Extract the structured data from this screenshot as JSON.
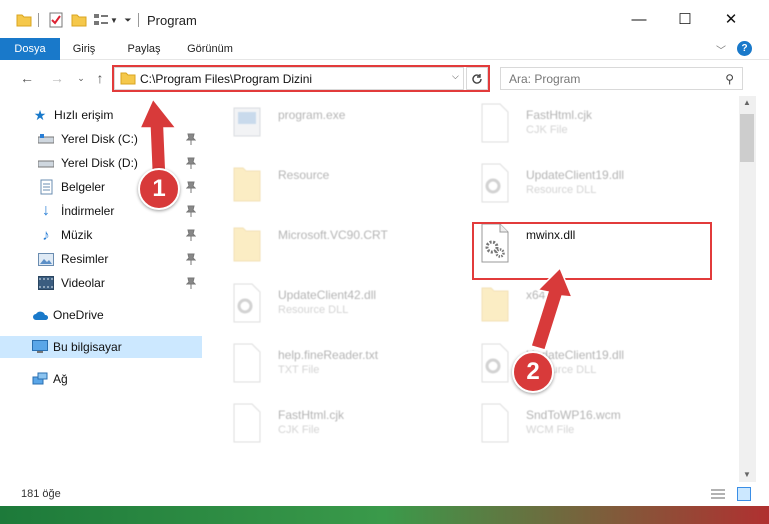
{
  "window": {
    "title": "Program",
    "controls": {
      "minimize": "—",
      "maximize": "☐",
      "close": "✕"
    }
  },
  "ribbon": {
    "tabs": [
      {
        "label": "Dosya",
        "active": true
      },
      {
        "label": "Giriş",
        "active": false
      },
      {
        "label": "Paylaş",
        "active": false
      },
      {
        "label": "Görünüm",
        "active": false
      }
    ]
  },
  "address": {
    "path": "C:\\Program Files\\Program Dizini",
    "search_placeholder": "Ara: Program"
  },
  "sidebar": {
    "quick_access": "Hızlı erişim",
    "items": [
      {
        "label": "Yerel Disk (C:)",
        "icon": "drive-icon"
      },
      {
        "label": "Yerel Disk (D:)",
        "icon": "drive-icon"
      },
      {
        "label": "Belgeler",
        "icon": "documents-icon"
      },
      {
        "label": "İndirmeler",
        "icon": "downloads-icon"
      },
      {
        "label": "Müzik",
        "icon": "music-icon"
      },
      {
        "label": "Resimler",
        "icon": "pictures-icon"
      },
      {
        "label": "Videolar",
        "icon": "videos-icon"
      }
    ],
    "onedrive": "OneDrive",
    "this_pc": "Bu bilgisayar",
    "network": "Ağ"
  },
  "files": {
    "left": [
      {
        "name": "program.exe",
        "type": "",
        "icon": "exe-icon"
      },
      {
        "name": "Resource",
        "type": "",
        "icon": "folder-icon"
      },
      {
        "name": "Microsoft.VC90.CRT",
        "type": "",
        "icon": "folder-icon"
      },
      {
        "name": "UpdateClient42.dll",
        "type": "Resource DLL",
        "icon": "dll-icon"
      },
      {
        "name": "help.fineReader.txt",
        "type": "TXT File",
        "icon": "txt-icon"
      },
      {
        "name": "FastHtml.cjk",
        "type": "CJK File",
        "icon": "file-icon"
      }
    ],
    "right": [
      {
        "name": "FastHtml.cjk",
        "type": "CJK File",
        "icon": "file-icon"
      },
      {
        "name": "UpdateClient19.dll",
        "type": "Resource DLL",
        "icon": "dll-icon"
      },
      {
        "name": "mwinx.dll",
        "type": "",
        "icon": "dll-icon"
      },
      {
        "name": "x64",
        "type": "",
        "icon": "folder-icon"
      },
      {
        "name": "UpdateClient19.dll",
        "type": "Resource DLL",
        "icon": "dll-icon"
      },
      {
        "name": "SndToWP16.wcm",
        "type": "WCM File",
        "icon": "file-icon"
      }
    ]
  },
  "status": {
    "item_count": "181 öğe"
  },
  "markers": {
    "step1": "1",
    "step2": "2"
  },
  "colors": {
    "accent": "#1979ca",
    "highlight": "#e23b3b",
    "marker": "#d83a3a",
    "selection": "#cce8ff"
  }
}
